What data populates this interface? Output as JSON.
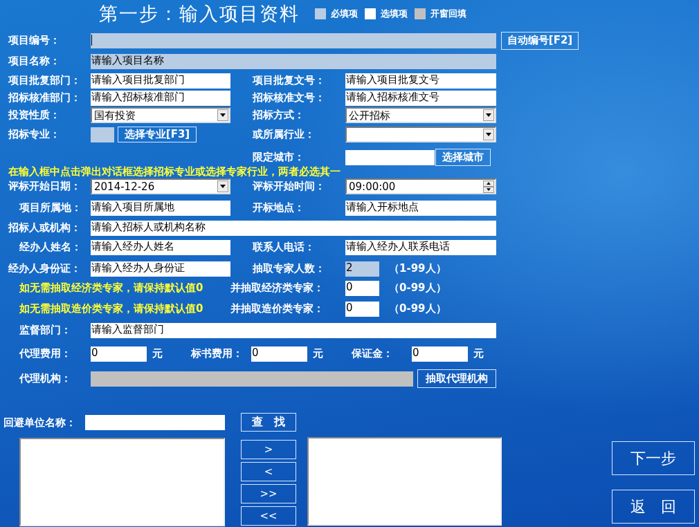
{
  "title": "第一步：输入项目资料",
  "legend": [
    {
      "label": "必填项",
      "color": "#b8cce4"
    },
    {
      "label": "选填项",
      "color": "#ffffff"
    },
    {
      "label": "开窗回填",
      "color": "#c0c0c0"
    }
  ],
  "rows": [
    {
      "items": [
        {
          "kind": "label",
          "text": "项目编号："
        },
        {
          "kind": "input",
          "color": "#b8cce4",
          "focused": true
        },
        {
          "kind": "button",
          "text": "自动编号[F2]"
        }
      ]
    },
    {
      "items": [
        {
          "kind": "label",
          "text": "项目名称："
        },
        {
          "kind": "input",
          "color": "#b8cce4",
          "value": "请输入项目名称"
        }
      ]
    },
    {
      "items": [
        {
          "kind": "label",
          "text": "项目批复部门："
        },
        {
          "kind": "input",
          "color": "#ffffff",
          "value": "请输入项目批复部门"
        },
        {
          "kind": "label",
          "text": "项目批复文号："
        },
        {
          "kind": "input",
          "color": "#ffffff",
          "value": "请输入项目批复文号"
        }
      ]
    },
    {
      "items": [
        {
          "kind": "label",
          "text": "招标核准部门："
        },
        {
          "kind": "input",
          "color": "#ffffff",
          "value": "请输入招标核准部门"
        },
        {
          "kind": "label",
          "text": "招标核准文号："
        },
        {
          "kind": "input",
          "color": "#ffffff",
          "value": "请输入招标核准文号"
        }
      ]
    },
    {
      "items": [
        {
          "kind": "label",
          "text": "投资性质："
        },
        {
          "kind": "select",
          "color": "#ffffff",
          "value": "国有投资"
        },
        {
          "kind": "label",
          "text": "招标方式："
        },
        {
          "kind": "select",
          "color": "#ffffff",
          "value": "公开招标"
        }
      ]
    },
    {
      "items": [
        {
          "kind": "label",
          "text": "招标专业："
        },
        {
          "kind": "input",
          "color": "#b8cce4"
        },
        {
          "kind": "button",
          "text": "选择专业[F3]"
        },
        {
          "kind": "label",
          "text": "或所属行业："
        },
        {
          "kind": "select",
          "color": "#ffffff"
        }
      ]
    },
    {
      "items": [
        {
          "kind": "label",
          "text": "限定城市："
        },
        {
          "kind": "input",
          "color": "#ffffff"
        },
        {
          "kind": "button",
          "text": "选择城市"
        }
      ]
    },
    {
      "items": [
        {
          "kind": "note",
          "text": "在输入框中点击弹出对话框选择招标专业或选择专家行业，两者必选其一"
        }
      ]
    },
    {
      "items": [
        {
          "kind": "label",
          "text": "评标开始日期："
        },
        {
          "kind": "select",
          "color": "#ffffff",
          "value": "2014-12-26"
        },
        {
          "kind": "label",
          "text": "评标开始时间："
        },
        {
          "kind": "spinner",
          "color": "#ffffff",
          "value": "09:00:00"
        }
      ]
    },
    {
      "items": [
        {
          "kind": "label",
          "text": "项目所属地："
        },
        {
          "kind": "input",
          "color": "#ffffff",
          "value": "请输入项目所属地"
        },
        {
          "kind": "label",
          "text": "开标地点："
        },
        {
          "kind": "input",
          "color": "#ffffff",
          "value": "请输入开标地点"
        }
      ]
    },
    {
      "items": [
        {
          "kind": "label",
          "text": "招标人或机构："
        },
        {
          "kind": "input",
          "color": "#ffffff",
          "value": "请输入招标人或机构名称"
        }
      ]
    },
    {
      "items": [
        {
          "kind": "label",
          "text": "经办人姓名："
        },
        {
          "kind": "input",
          "color": "#ffffff",
          "value": "请输入经办人姓名"
        },
        {
          "kind": "label",
          "text": "联系人电话："
        },
        {
          "kind": "input",
          "color": "#ffffff",
          "value": "请输入经办人联系电话"
        }
      ]
    },
    {
      "items": [
        {
          "kind": "label",
          "text": "经办人身份证："
        },
        {
          "kind": "input",
          "color": "#ffffff",
          "value": "请输入经办人身份证"
        },
        {
          "kind": "label",
          "text": "抽取专家人数："
        },
        {
          "kind": "input",
          "color": "#b8cce4",
          "value": "2"
        },
        {
          "kind": "unit",
          "text": "（1-99人）"
        }
      ]
    },
    {
      "items": [
        {
          "kind": "note",
          "text": "如无需抽取经济类专家，请保持默认值0"
        },
        {
          "kind": "label",
          "text": "并抽取经济类专家："
        },
        {
          "kind": "input",
          "color": "#ffffff",
          "value": "0"
        },
        {
          "kind": "unit",
          "text": "（0-99人）"
        }
      ]
    },
    {
      "items": [
        {
          "kind": "note",
          "text": "如无需抽取造价类专家，请保持默认值0"
        },
        {
          "kind": "label",
          "text": "并抽取造价类专家："
        },
        {
          "kind": "input",
          "color": "#ffffff",
          "value": "0"
        },
        {
          "kind": "unit",
          "text": "（0-99人）"
        }
      ]
    },
    {
      "items": [
        {
          "kind": "label",
          "text": "监督部门："
        },
        {
          "kind": "input",
          "color": "#ffffff",
          "value": "请输入监督部门"
        }
      ]
    },
    {
      "items": [
        {
          "kind": "label",
          "text": "代理费用："
        },
        {
          "kind": "input",
          "color": "#ffffff",
          "value": "0"
        },
        {
          "kind": "unit",
          "text": "元"
        },
        {
          "kind": "label",
          "text": "标书费用："
        },
        {
          "kind": "input",
          "color": "#ffffff",
          "value": "0"
        },
        {
          "kind": "unit",
          "text": "元"
        },
        {
          "kind": "label",
          "text": "保证金："
        },
        {
          "kind": "input",
          "color": "#ffffff",
          "value": "0"
        },
        {
          "kind": "unit",
          "text": "元"
        }
      ]
    },
    {
      "items": [
        {
          "kind": "label",
          "text": "代理机构："
        },
        {
          "kind": "input",
          "color": "#c0c0c0"
        },
        {
          "kind": "button",
          "text": "抽取代理机构"
        }
      ]
    }
  ],
  "avoid_units": {
    "label": "回避单位名称：",
    "search_button": "查　找",
    "transfer_buttons": [
      ">",
      "<",
      ">>",
      "<<"
    ]
  },
  "nav_buttons": [
    "下一步",
    "返　回"
  ]
}
